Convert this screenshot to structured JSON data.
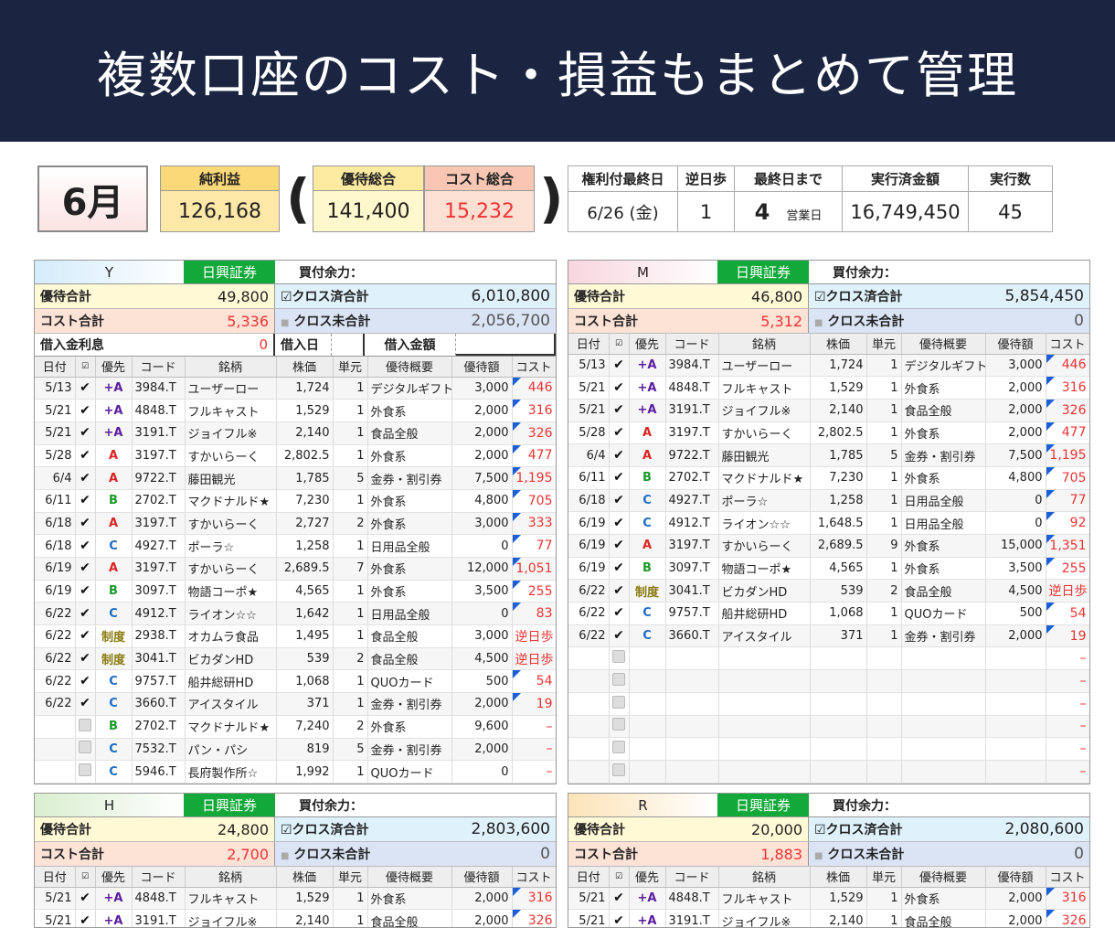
{
  "banner": {
    "title": "複数口座のコスト・損益もまとめて管理"
  },
  "summary": {
    "month": "6月",
    "net_label": "純利益",
    "net": "126,168",
    "yutai_label": "優待総合",
    "yutai": "141,400",
    "cost_label": "コスト総合",
    "cost": "15,232",
    "paren_open": "(",
    "paren_close": ")",
    "headers": [
      "権利付最終日",
      "逆日歩",
      "最終日まで",
      "実行済金額",
      "実行数"
    ],
    "last_day": "6/26 (金)",
    "gyaku": "1",
    "days_left": "4",
    "days_unit": "営業日",
    "executed": "16,749,450",
    "count": "45"
  },
  "labels": {
    "broker": "日興証券",
    "kaitsuke": "買付余力：",
    "yutai_total": "優待合計",
    "cost_total": "コスト合計",
    "cross_done": "☑クロス済合計",
    "cross_undone": "クロス未合計",
    "loan_interest": "借入金利息",
    "loan_date": "借入日",
    "loan_amount": "借入金額",
    "cols": [
      "日付",
      "☑",
      "優先",
      "コード",
      "銘柄",
      "株価",
      "単元",
      "優待概要",
      "優待額",
      "コスト"
    ]
  },
  "colors": {
    "banner": "#1b2542",
    "broker": "#12a83a",
    "cost": "#e33"
  },
  "panels": [
    {
      "name": "Y",
      "yutai": "49,800",
      "cost": "5,336",
      "cross_done": "6,010,800",
      "cross_undone": "2,056,700",
      "loan_interest": "0",
      "has_loan": true,
      "rows": [
        [
          "5/13",
          true,
          "+A",
          "3984.T",
          "ユーザーロー",
          "1,724",
          "1",
          "デジタルギフト",
          "3,000",
          "446"
        ],
        [
          "5/21",
          true,
          "+A",
          "4848.T",
          "フルキャスト",
          "1,529",
          "1",
          "外食系",
          "2,000",
          "316"
        ],
        [
          "5/21",
          true,
          "+A",
          "3191.T",
          "ジョイフル※",
          "2,140",
          "1",
          "食品全般",
          "2,000",
          "326"
        ],
        [
          "5/28",
          true,
          "A",
          "3197.T",
          "すかいらーく",
          "2,802.5",
          "1",
          "外食系",
          "2,000",
          "477"
        ],
        [
          "6/4",
          true,
          "A",
          "9722.T",
          "藤田観光",
          "1,785",
          "5",
          "金券・割引券",
          "7,500",
          "1,195"
        ],
        [
          "6/11",
          true,
          "B",
          "2702.T",
          "マクドナルド★",
          "7,230",
          "1",
          "外食系",
          "4,800",
          "705"
        ],
        [
          "6/18",
          true,
          "A",
          "3197.T",
          "すかいらーく",
          "2,727",
          "2",
          "外食系",
          "3,000",
          "333"
        ],
        [
          "6/18",
          true,
          "C",
          "4927.T",
          "ポーラ☆",
          "1,258",
          "1",
          "日用品全般",
          "0",
          "77"
        ],
        [
          "6/19",
          true,
          "A",
          "3197.T",
          "すかいらーく",
          "2,689.5",
          "7",
          "外食系",
          "12,000",
          "1,051"
        ],
        [
          "6/19",
          true,
          "B",
          "3097.T",
          "物語コーポ★",
          "4,565",
          "1",
          "外食系",
          "3,500",
          "255"
        ],
        [
          "6/22",
          true,
          "C",
          "4912.T",
          "ライオン☆☆",
          "1,642",
          "1",
          "日用品全般",
          "0",
          "83"
        ],
        [
          "6/22",
          true,
          "制度",
          "2938.T",
          "オカムラ食品",
          "1,495",
          "1",
          "食品全般",
          "3,000",
          "逆日歩"
        ],
        [
          "6/22",
          true,
          "制度",
          "3041.T",
          "ビカダンHD",
          "539",
          "2",
          "食品全般",
          "4,500",
          "逆日歩"
        ],
        [
          "6/22",
          true,
          "C",
          "9757.T",
          "船井総研HD",
          "1,068",
          "1",
          "QUOカード",
          "500",
          "54"
        ],
        [
          "6/22",
          true,
          "C",
          "3660.T",
          "アイスタイル",
          "371",
          "1",
          "金券・割引券",
          "2,000",
          "19"
        ],
        [
          "",
          false,
          "B",
          "2702.T",
          "マクドナルド★",
          "7,240",
          "2",
          "外食系",
          "9,600",
          "–"
        ],
        [
          "",
          false,
          "C",
          "7532.T",
          "パン・パシ",
          "819",
          "5",
          "金券・割引券",
          "2,000",
          "–"
        ],
        [
          "",
          false,
          "C",
          "5946.T",
          "長府製作所☆",
          "1,992",
          "1",
          "QUOカード",
          "0",
          "–"
        ]
      ]
    },
    {
      "name": "M",
      "yutai": "46,800",
      "cost": "5,312",
      "cross_done": "5,854,450",
      "cross_undone": "0",
      "has_loan": false,
      "rows": [
        [
          "5/13",
          true,
          "+A",
          "3984.T",
          "ユーザーロー",
          "1,724",
          "1",
          "デジタルギフト",
          "3,000",
          "446"
        ],
        [
          "5/21",
          true,
          "+A",
          "4848.T",
          "フルキャスト",
          "1,529",
          "1",
          "外食系",
          "2,000",
          "316"
        ],
        [
          "5/21",
          true,
          "+A",
          "3191.T",
          "ジョイフル※",
          "2,140",
          "1",
          "食品全般",
          "2,000",
          "326"
        ],
        [
          "5/28",
          true,
          "A",
          "3197.T",
          "すかいらーく",
          "2,802.5",
          "1",
          "外食系",
          "2,000",
          "477"
        ],
        [
          "6/4",
          true,
          "A",
          "9722.T",
          "藤田観光",
          "1,785",
          "5",
          "金券・割引券",
          "7,500",
          "1,195"
        ],
        [
          "6/11",
          true,
          "B",
          "2702.T",
          "マクドナルド★",
          "7,230",
          "1",
          "外食系",
          "4,800",
          "705"
        ],
        [
          "6/18",
          true,
          "C",
          "4927.T",
          "ポーラ☆",
          "1,258",
          "1",
          "日用品全般",
          "0",
          "77"
        ],
        [
          "6/19",
          true,
          "C",
          "4912.T",
          "ライオン☆☆",
          "1,648.5",
          "1",
          "日用品全般",
          "0",
          "92"
        ],
        [
          "6/19",
          true,
          "A",
          "3197.T",
          "すかいらーく",
          "2,689.5",
          "9",
          "外食系",
          "15,000",
          "1,351"
        ],
        [
          "6/19",
          true,
          "B",
          "3097.T",
          "物語コーポ★",
          "4,565",
          "1",
          "外食系",
          "3,500",
          "255"
        ],
        [
          "6/22",
          true,
          "制度",
          "3041.T",
          "ビカダンHD",
          "539",
          "2",
          "食品全般",
          "4,500",
          "逆日歩"
        ],
        [
          "6/22",
          true,
          "C",
          "9757.T",
          "船井総研HD",
          "1,068",
          "1",
          "QUOカード",
          "500",
          "54"
        ],
        [
          "6/22",
          true,
          "C",
          "3660.T",
          "アイスタイル",
          "371",
          "1",
          "金券・割引券",
          "2,000",
          "19"
        ],
        [
          "",
          false,
          "",
          "",
          "",
          "",
          "",
          "",
          "",
          "–"
        ],
        [
          "",
          false,
          "",
          "",
          "",
          "",
          "",
          "",
          "",
          "–"
        ],
        [
          "",
          false,
          "",
          "",
          "",
          "",
          "",
          "",
          "",
          "–"
        ],
        [
          "",
          false,
          "",
          "",
          "",
          "",
          "",
          "",
          "",
          "–"
        ],
        [
          "",
          false,
          "",
          "",
          "",
          "",
          "",
          "",
          "",
          "–"
        ],
        [
          "",
          false,
          "",
          "",
          "",
          "",
          "",
          "",
          "",
          "–"
        ]
      ]
    },
    {
      "name": "H",
      "yutai": "24,800",
      "cost": "2,700",
      "cross_done": "2,803,600",
      "cross_undone": "0",
      "has_loan": false,
      "rows": [
        [
          "5/21",
          true,
          "+A",
          "4848.T",
          "フルキャスト",
          "1,529",
          "1",
          "外食系",
          "2,000",
          "316"
        ],
        [
          "5/21",
          true,
          "+A",
          "3191.T",
          "ジョイフル※",
          "2,140",
          "1",
          "食品全般",
          "2,000",
          "326"
        ]
      ]
    },
    {
      "name": "R",
      "yutai": "20,000",
      "cost": "1,883",
      "cross_done": "2,080,600",
      "cross_undone": "0",
      "has_loan": false,
      "rows": [
        [
          "5/21",
          true,
          "+A",
          "4848.T",
          "フルキャスト",
          "1,529",
          "1",
          "外食系",
          "2,000",
          "316"
        ],
        [
          "5/21",
          true,
          "+A",
          "3191.T",
          "ジョイフル※",
          "2,140",
          "1",
          "食品全般",
          "2,000",
          "326"
        ]
      ]
    }
  ]
}
